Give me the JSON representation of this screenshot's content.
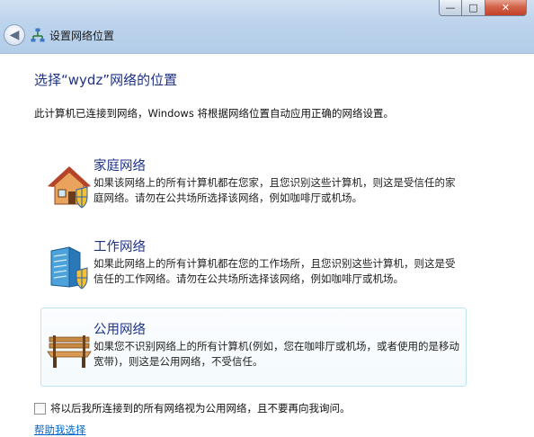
{
  "window": {
    "title": "设置网络位置",
    "minimize_glyph": "—",
    "maximize_glyph": "□",
    "close_glyph": "✕",
    "back_glyph": "◀"
  },
  "main": {
    "heading": "选择“wydz”网络的位置",
    "intro": "此计算机已连接到网络，Windows 将根据网络位置自动应用正确的网络设置。",
    "options": [
      {
        "title": "家庭网络",
        "description": "如果该网络上的所有计算机都在您家，且您识别这些计算机，则这是受信任的家庭网络。请勿在公共场所选择该网络，例如咖啡厅或机场。",
        "icon": "home-icon"
      },
      {
        "title": "工作网络",
        "description": "如果此网络上的所有计算机都在您的工作场所，且您识别这些计算机，则这是受信任的工作网络。请勿在公共场所选择该网络，例如咖啡厅或机场。",
        "icon": "work-building-icon"
      },
      {
        "title": "公用网络",
        "description": "如果您不识别网络上的所有计算机(例如，您在咖啡厅或机场，或者使用的是移动宽带)，则这是公用网络，不受信任。",
        "icon": "park-bench-icon"
      }
    ],
    "checkbox_label": "将以后我所连接到的所有网络视为公用网络，且不要再向我询问。",
    "checkbox_checked": false,
    "help_link": "帮助我选择"
  },
  "colors": {
    "heading": "#1e3287",
    "link": "#0066cc",
    "highlight_border": "#bfe4f5"
  }
}
